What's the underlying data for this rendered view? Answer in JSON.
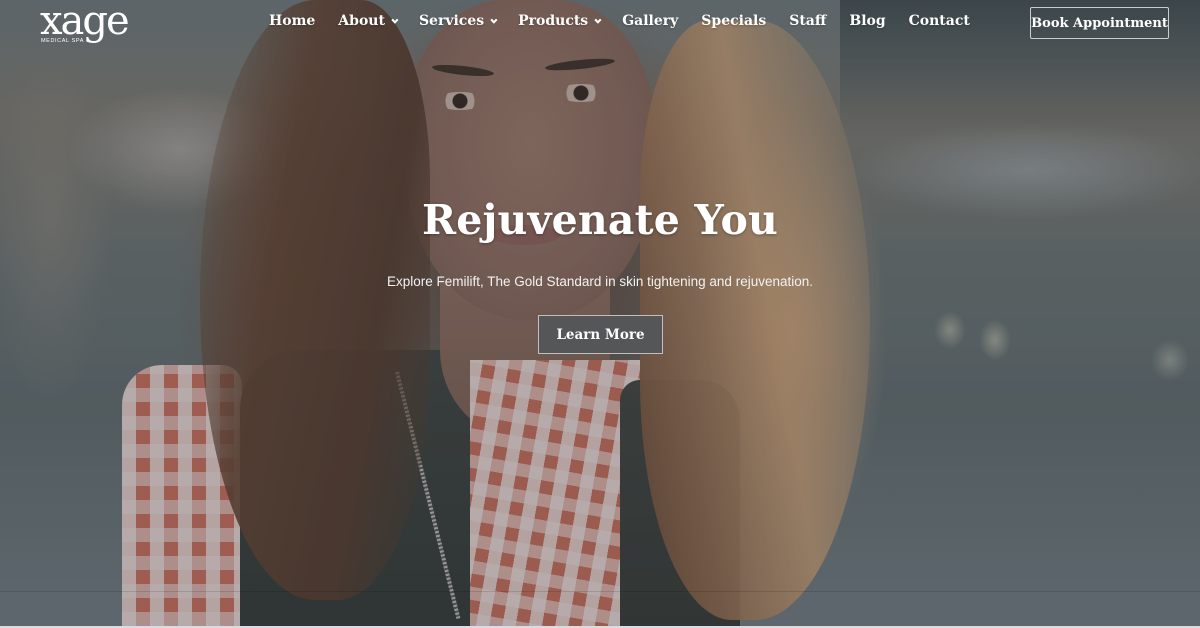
{
  "brand": {
    "logo_word": "xage",
    "logo_subtitle": "MEDICAL SPA"
  },
  "nav": {
    "items": [
      {
        "label": "Home",
        "has_dropdown": false
      },
      {
        "label": "About",
        "has_dropdown": true
      },
      {
        "label": "Services",
        "has_dropdown": true
      },
      {
        "label": "Products",
        "has_dropdown": true
      },
      {
        "label": "Gallery",
        "has_dropdown": false
      },
      {
        "label": "Specials",
        "has_dropdown": false
      },
      {
        "label": "Staff",
        "has_dropdown": false
      },
      {
        "label": "Blog",
        "has_dropdown": false
      },
      {
        "label": "Contact",
        "has_dropdown": false
      }
    ],
    "cta_label": "Book Appointment"
  },
  "hero": {
    "title": "Rejuvenate You",
    "subtitle": "Explore Femilift, The Gold Standard in skin tightening and rejuvenation.",
    "button_label": "Learn More",
    "background_description": "Woman with long wavy auburn hair wearing red-and-white gingham shirt and dark vest, blurred street background, grey overlay"
  },
  "colors": {
    "overlay": "#5d6a70",
    "text": "#ffffff",
    "button_bg": "#545657",
    "button_border": "#bfbfbf"
  }
}
